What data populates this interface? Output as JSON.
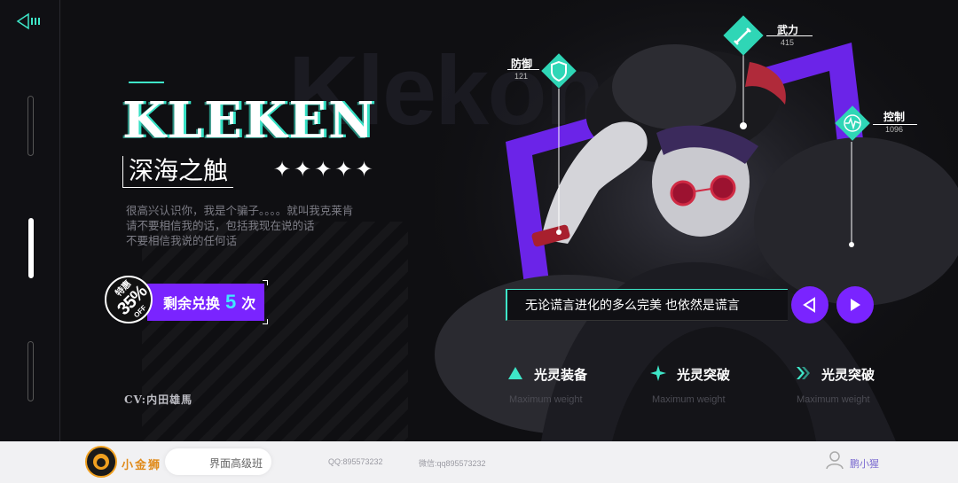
{
  "sidebar": {
    "back_icon": "back-arrow-icon"
  },
  "hero": {
    "bg_title": "Klekon",
    "title": "KLEKEN",
    "subtitle": "深海之触",
    "stars": "✦✦✦✦✦",
    "rating": 5,
    "description": [
      "很高兴认识你，我是个骗子。。。。就叫我克莱肯",
      "请不要相信我的话，包括我现在说的话",
      "不要相信我说的任何话"
    ],
    "badge": {
      "line1": "特惠",
      "line2": "35%",
      "line3": "OFF"
    },
    "redeem": {
      "prefix": "剩余兑换",
      "count": "5",
      "suffix": "次"
    },
    "cv": "CV:内田雄馬"
  },
  "stats": [
    {
      "label": "防御",
      "value": "121",
      "icon": "shield-icon"
    },
    {
      "label": "武力",
      "value": "415",
      "icon": "sword-icon"
    },
    {
      "label": "控制",
      "value": "1096",
      "icon": "pulse-icon"
    }
  ],
  "quote": {
    "text": "无论谎言进化的多么完美 也依然是谎言"
  },
  "features": [
    {
      "label": "光灵装备",
      "sub": "Maximum weight",
      "icon": "triangle-icon"
    },
    {
      "label": "光灵突破",
      "sub": "Maximum weight",
      "icon": "sparkle-icon"
    },
    {
      "label": "光灵突破",
      "sub": "Maximum weight",
      "icon": "double-chevron-icon"
    }
  ],
  "footer": {
    "brand": "小金狮",
    "course": "界面高级班",
    "qq": "QQ:895573232",
    "wechat": "微信:qq895573232",
    "author": "鹏小猩"
  },
  "colors": {
    "accent": "#3ee6c8",
    "purple": "#7a24ff",
    "bg": "#0f0f12"
  }
}
